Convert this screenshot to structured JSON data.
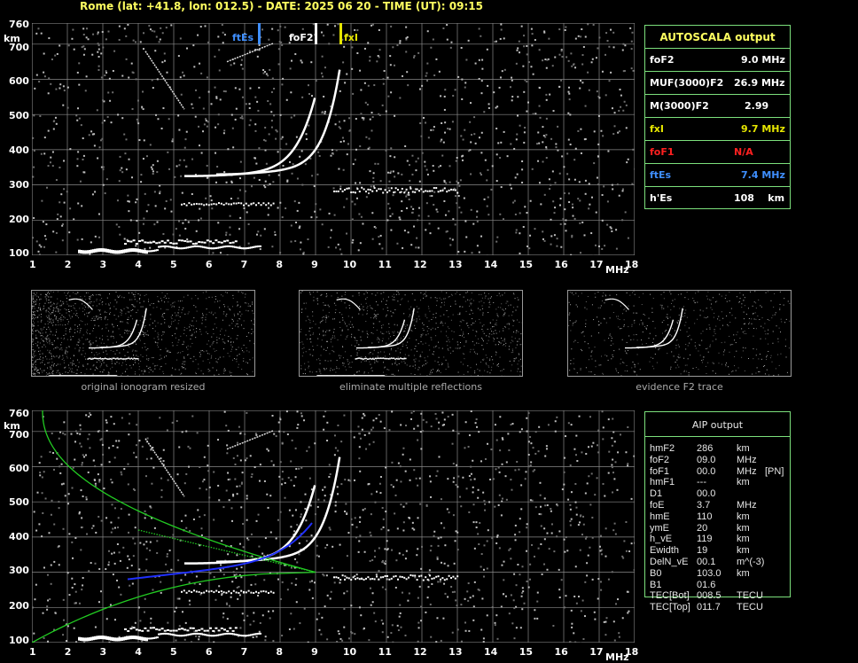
{
  "header": "Rome (lat: +41.8, lon: 012.5) - DATE: 2025 06 20 - TIME (UT): 09:15",
  "axes": {
    "y_unit": "km",
    "x_unit": "MHz",
    "y_ticks": [
      "760",
      "700",
      "600",
      "500",
      "400",
      "300",
      "200",
      "100"
    ],
    "x_ticks": [
      "1",
      "2",
      "3",
      "4",
      "5",
      "6",
      "7",
      "8",
      "9",
      "10",
      "11",
      "12",
      "13",
      "14",
      "15",
      "16",
      "17",
      "18"
    ]
  },
  "markers": {
    "ftEs": "ftEs",
    "foF2": "foF2",
    "fxI": "fxI"
  },
  "autoscala": {
    "title": "AUTOSCALA output",
    "rows": [
      {
        "label": "foF2",
        "value": "9.0 MHz",
        "color": "#ffffff"
      },
      {
        "label": "MUF(3000)F2",
        "value": "26.9 MHz",
        "color": "#ffffff"
      },
      {
        "label": "M(3000)F2",
        "value": "2.99",
        "color": "#ffffff"
      },
      {
        "label": "fxI",
        "value": "9.7 MHz",
        "color": "#e6e600"
      },
      {
        "label": "foF1",
        "value": "N/A",
        "color": "#ff2020"
      },
      {
        "label": "ftEs",
        "value": "7.4 MHz",
        "color": "#3f8fff"
      },
      {
        "label": "h'Es",
        "value": "108    km",
        "color": "#ffffff"
      }
    ]
  },
  "thumb_captions": [
    "original ionogram resized",
    "eliminate multiple reflections",
    "evidence F2 trace"
  ],
  "aip": {
    "title": "AIP output",
    "rows": [
      {
        "name": "hmF2",
        "value": "286",
        "unit": "km",
        "extra": ""
      },
      {
        "name": "foF2",
        "value": "09.0",
        "unit": "MHz",
        "extra": ""
      },
      {
        "name": "foF1",
        "value": "00.0",
        "unit": "MHz",
        "extra": "[PN]"
      },
      {
        "name": "hmF1",
        "value": "---",
        "unit": "km",
        "extra": ""
      },
      {
        "name": "D1",
        "value": "00.0",
        "unit": "",
        "extra": ""
      },
      {
        "name": "foE",
        "value": "3.7",
        "unit": "MHz",
        "extra": ""
      },
      {
        "name": "hmE",
        "value": "110",
        "unit": "km",
        "extra": ""
      },
      {
        "name": "ymE",
        "value": "20",
        "unit": "km",
        "extra": ""
      },
      {
        "name": "h_vE",
        "value": "119",
        "unit": "km",
        "extra": ""
      },
      {
        "name": "Ewidth",
        "value": "19",
        "unit": "km",
        "extra": ""
      },
      {
        "name": "DelN_vE",
        "value": "00.1",
        "unit": "m^(-3)",
        "extra": ""
      },
      {
        "name": "B0",
        "value": "103.0",
        "unit": "km",
        "extra": ""
      },
      {
        "name": "B1",
        "value": "01.6",
        "unit": "",
        "extra": ""
      },
      {
        "name": "TEC[Bot]",
        "value": "008.5",
        "unit": "TECU",
        "extra": ""
      },
      {
        "name": "TEC[Top]",
        "value": "011.7",
        "unit": "TECU",
        "extra": ""
      }
    ]
  },
  "colors": {
    "grid": "#8a8a8a",
    "trace": "#ffffff",
    "ftEs": "#3f8fff",
    "fxI": "#e6e600",
    "profile": "#22cc22",
    "fit": "#2030ff",
    "panel_border": "#7ce07c"
  }
}
